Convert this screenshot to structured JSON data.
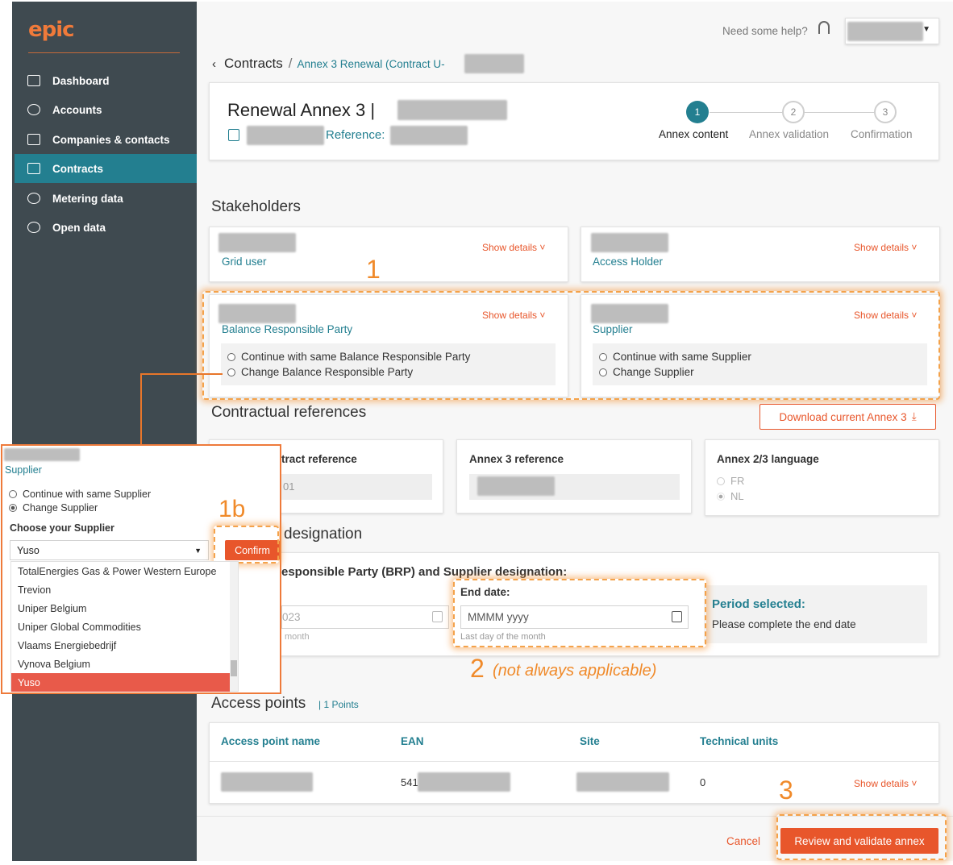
{
  "app": {
    "logo": "epic"
  },
  "sidebar": {
    "items": [
      {
        "label": "Dashboard",
        "icon": "dashboard-icon"
      },
      {
        "label": "Accounts",
        "icon": "accounts-icon"
      },
      {
        "label": "Companies & contacts",
        "icon": "companies-icon"
      },
      {
        "label": "Contracts",
        "icon": "contracts-icon",
        "active": true
      },
      {
        "label": "Metering data",
        "icon": "metering-icon"
      },
      {
        "label": "Open data",
        "icon": "open-data-icon"
      }
    ]
  },
  "header": {
    "help": "Need some help?"
  },
  "breadcrumb": {
    "root": "Contracts",
    "sep": "/",
    "current": "Annex 3 Renewal (Contract U-"
  },
  "title_card": {
    "title": "Renewal Annex 3 |",
    "reference_label": "Reference:",
    "steps": [
      {
        "num": "1",
        "label": "Annex content"
      },
      {
        "num": "2",
        "label": "Annex validation"
      },
      {
        "num": "3",
        "label": "Confirmation"
      }
    ]
  },
  "stakeholders": {
    "title": "Stakeholders",
    "show_details": "Show details",
    "grid_user": "Grid user",
    "access_holder": "Access Holder",
    "brp": "Balance Responsible Party",
    "brp_opt1": "Continue with same Balance Responsible Party",
    "brp_opt2": "Change Balance Responsible Party",
    "supplier": "Supplier",
    "sup_opt1": "Continue with same Supplier",
    "sup_opt2": "Change Supplier"
  },
  "contractual": {
    "title": "Contractual references",
    "download": "Download current Annex 3",
    "contract_ref_label": "tract reference",
    "contract_ref_value": "01",
    "annex3_ref_label": "Annex 3 reference",
    "language_label": "Annex 2/3 language",
    "lang_fr": "FR",
    "lang_nl": "NL"
  },
  "designation": {
    "title": "designation",
    "subtitle": "esponsible Party (BRP) and Supplier designation:",
    "start_value": "023",
    "start_hint": "month",
    "end_label": "End date:",
    "end_placeholder": "MMMM yyyy",
    "end_hint": "Last day of the month",
    "period_title": "Period selected:",
    "period_text": "Please complete the end date"
  },
  "access_points": {
    "title": "Access points",
    "count": "| 1 Points",
    "columns": [
      "Access point name",
      "EAN",
      "Site",
      "Technical units"
    ],
    "row": {
      "ean_prefix": "541",
      "technical_units": "0",
      "show_details": "Show details"
    }
  },
  "footer": {
    "cancel": "Cancel",
    "review": "Review and validate annex"
  },
  "annotations": {
    "n1": "1",
    "n1b": "1b",
    "n2": "2",
    "n2_note": "(not always applicable)",
    "n3": "3"
  },
  "popup": {
    "label": "Supplier",
    "opt1": "Continue with same Supplier",
    "opt2": "Change Supplier",
    "choose": "Choose your Supplier",
    "input_value": "Yuso",
    "confirm": "Confirm",
    "options": [
      "TotalEnergies Gas & Power Western Europe",
      "Trevion",
      "Uniper Belgium",
      "Uniper Global Commodities",
      "Vlaams Energiebedrijf",
      "Vynova Belgium",
      "Yuso"
    ]
  },
  "colors": {
    "accent": "#237f90",
    "orange": "#e8562b",
    "sidebar": "#3f4a50",
    "highlight": "#f4a24a"
  }
}
